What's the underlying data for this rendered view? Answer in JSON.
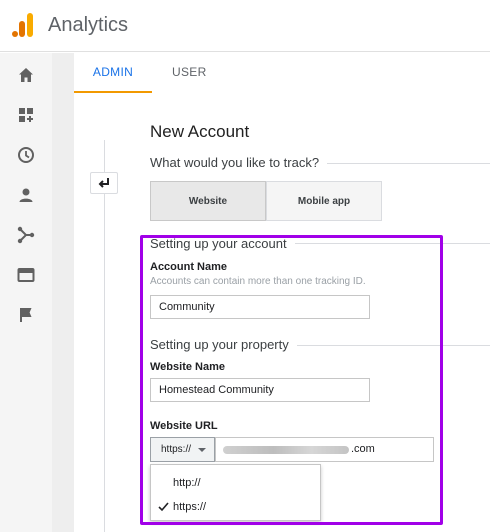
{
  "app": {
    "title": "Analytics"
  },
  "sidebar": {
    "items": [
      {
        "icon": "home-icon"
      },
      {
        "icon": "customization-icon"
      },
      {
        "icon": "clock-icon"
      },
      {
        "icon": "person-icon"
      },
      {
        "icon": "acquisition-icon"
      },
      {
        "icon": "behavior-icon"
      },
      {
        "icon": "flag-icon"
      }
    ]
  },
  "tabs": [
    {
      "label": "ADMIN",
      "active": true
    },
    {
      "label": "USER",
      "active": false
    }
  ],
  "page": {
    "title": "New Account",
    "track_prompt": "What would you like to track?"
  },
  "track_options": {
    "website": "Website",
    "mobile": "Mobile app",
    "selected": "Website"
  },
  "account": {
    "heading": "Setting up your account",
    "name_label": "Account Name",
    "name_help": "Accounts can contain more than one tracking ID.",
    "name_value": "Community"
  },
  "property": {
    "heading": "Setting up your property",
    "website_name_label": "Website Name",
    "website_name_value": "Homestead Community",
    "website_url_label": "Website URL",
    "protocol_selected": "https://",
    "url_suffix": ".com",
    "protocol_options": [
      "http://",
      "https://"
    ]
  },
  "colors": {
    "highlight": "#a100e8",
    "accent": "#1a73e8",
    "tab_indicator": "#f29900"
  }
}
